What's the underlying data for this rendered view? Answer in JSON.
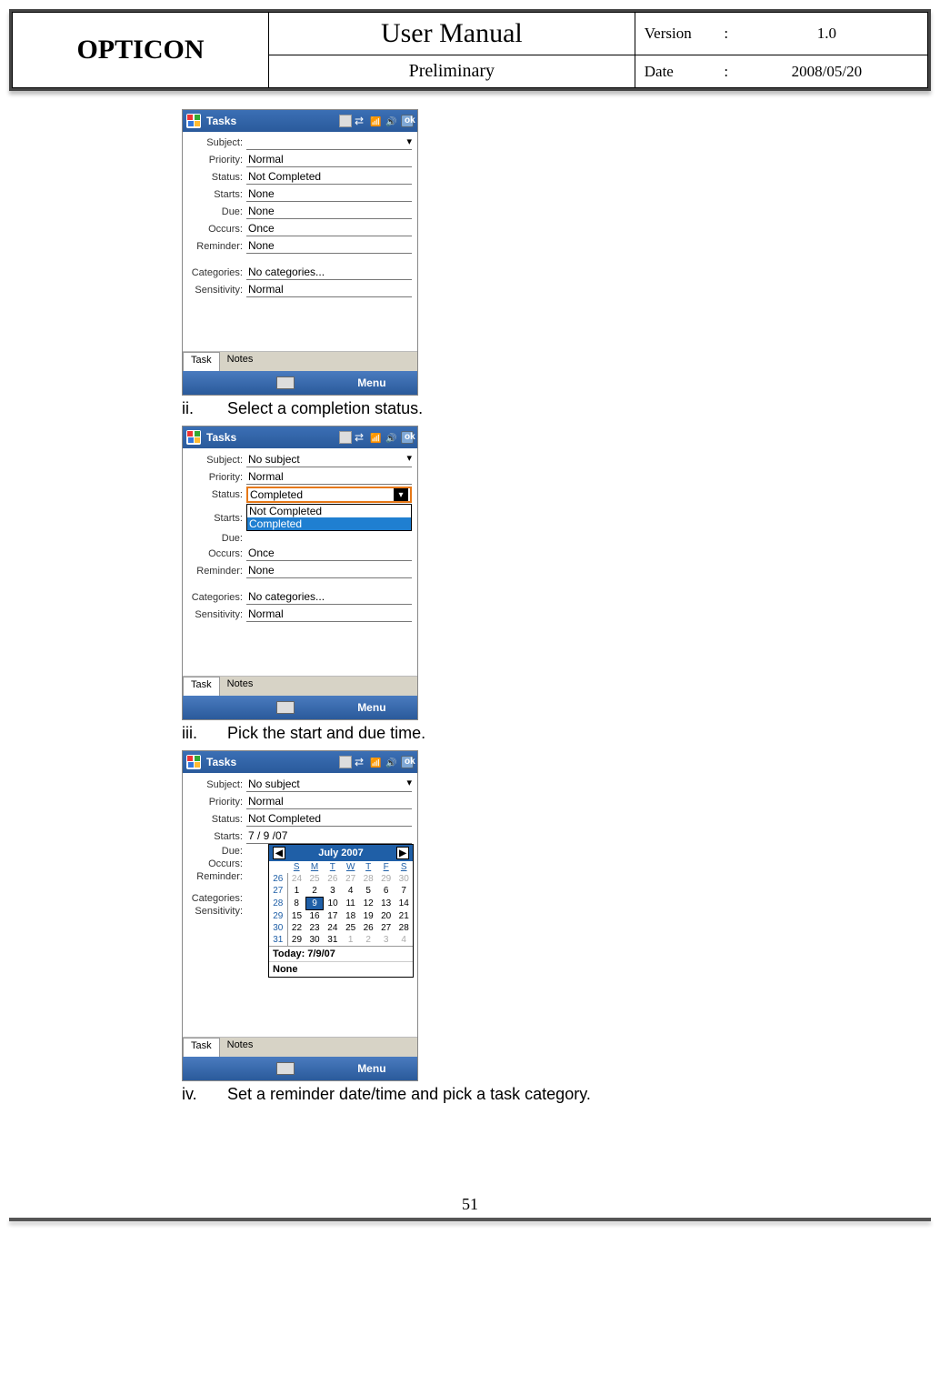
{
  "header": {
    "brand": "OPTICON",
    "title": "User Manual",
    "subtitle": "Preliminary",
    "version_label": "Version",
    "version_sep": ":",
    "version_value": "1.0",
    "date_label": "Date",
    "date_sep": ":",
    "date_value": "2008/05/20"
  },
  "ui": {
    "titlebar_app": "Tasks",
    "ok_button": "ok",
    "tab_task": "Task",
    "tab_notes": "Notes",
    "menu_label": "Menu"
  },
  "labels": {
    "subject": "Subject:",
    "priority": "Priority:",
    "status": "Status:",
    "starts": "Starts:",
    "due": "Due:",
    "occurs": "Occurs:",
    "reminder": "Reminder:",
    "categories": "Categories:",
    "sensitivity": "Sensitivity:"
  },
  "shot1": {
    "subject": "",
    "priority": "Normal",
    "status": "Not Completed",
    "starts": "None",
    "due": "None",
    "occurs": "Once",
    "reminder": "None",
    "categories": "No categories...",
    "sensitivity": "Normal"
  },
  "step_ii": {
    "num": "ii.",
    "text": "Select a completion status."
  },
  "shot2": {
    "subject": "No subject",
    "priority": "Normal",
    "status_selected": "Completed",
    "status_opt1": "Not Completed",
    "status_opt2": "Completed",
    "occurs": "Once",
    "reminder": "None",
    "categories": "No categories...",
    "sensitivity": "Normal"
  },
  "step_iii": {
    "num": "iii.",
    "text": "Pick the start and due time."
  },
  "shot3": {
    "subject": "No subject",
    "priority": "Normal",
    "status": "Not Completed",
    "starts": "7 / 9 /07",
    "cal_title": "July 2007",
    "cal_today": "Today: 7/9/07",
    "cal_none": "None"
  },
  "calendar": {
    "dow": [
      "S",
      "M",
      "T",
      "W",
      "T",
      "F",
      "S"
    ],
    "weeks": [
      "26",
      "27",
      "28",
      "29",
      "30",
      "31"
    ],
    "rows": [
      [
        {
          "v": "24",
          "d": true
        },
        {
          "v": "25",
          "d": true
        },
        {
          "v": "26",
          "d": true
        },
        {
          "v": "27",
          "d": true
        },
        {
          "v": "28",
          "d": true
        },
        {
          "v": "29",
          "d": true
        },
        {
          "v": "30",
          "d": true
        }
      ],
      [
        {
          "v": "1"
        },
        {
          "v": "2"
        },
        {
          "v": "3"
        },
        {
          "v": "4"
        },
        {
          "v": "5"
        },
        {
          "v": "6"
        },
        {
          "v": "7"
        }
      ],
      [
        {
          "v": "8"
        },
        {
          "v": "9",
          "sel": true
        },
        {
          "v": "10"
        },
        {
          "v": "11"
        },
        {
          "v": "12"
        },
        {
          "v": "13"
        },
        {
          "v": "14"
        }
      ],
      [
        {
          "v": "15"
        },
        {
          "v": "16"
        },
        {
          "v": "17"
        },
        {
          "v": "18"
        },
        {
          "v": "19"
        },
        {
          "v": "20"
        },
        {
          "v": "21"
        }
      ],
      [
        {
          "v": "22"
        },
        {
          "v": "23"
        },
        {
          "v": "24"
        },
        {
          "v": "25"
        },
        {
          "v": "26"
        },
        {
          "v": "27"
        },
        {
          "v": "28"
        }
      ],
      [
        {
          "v": "29"
        },
        {
          "v": "30"
        },
        {
          "v": "31"
        },
        {
          "v": "1",
          "d": true
        },
        {
          "v": "2",
          "d": true
        },
        {
          "v": "3",
          "d": true
        },
        {
          "v": "4",
          "d": true
        }
      ]
    ]
  },
  "step_iv": {
    "num": "iv.",
    "text": "Set a reminder date/time and pick a task category."
  },
  "page_number": "51"
}
